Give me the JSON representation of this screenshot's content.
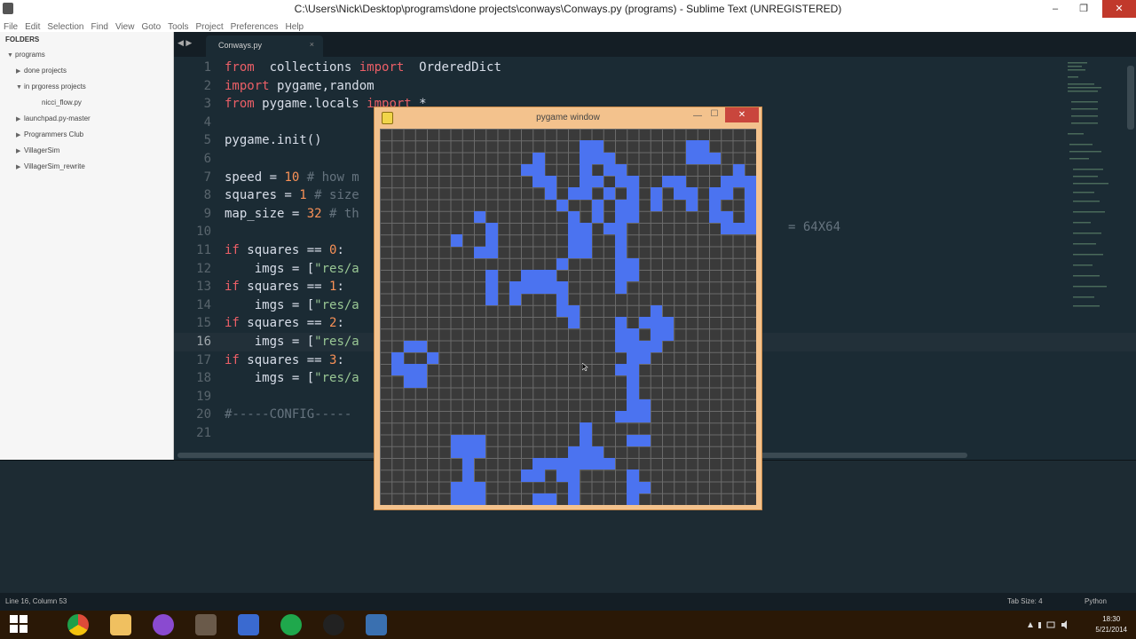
{
  "window": {
    "title": "C:\\Users\\Nick\\Desktop\\programs\\done projects\\conways\\Conways.py (programs) - Sublime Text (UNREGISTERED)",
    "minimize": "–",
    "maximize": "❐",
    "close": "✕"
  },
  "menu": [
    "File",
    "Edit",
    "Selection",
    "Find",
    "View",
    "Goto",
    "Tools",
    "Project",
    "Preferences",
    "Help"
  ],
  "sidebar": {
    "header": "FOLDERS",
    "items": [
      {
        "label": "programs",
        "arrow": "▼",
        "indent": 8
      },
      {
        "label": "done projects",
        "arrow": "▶",
        "indent": 18
      },
      {
        "label": "in prgoress projects",
        "arrow": "▼",
        "indent": 18
      },
      {
        "label": "nicci_flow.py",
        "arrow": "",
        "indent": 38
      },
      {
        "label": "launchpad.py-master",
        "arrow": "▶",
        "indent": 18
      },
      {
        "label": "Programmers Club",
        "arrow": "▶",
        "indent": 18
      },
      {
        "label": "VillagerSim",
        "arrow": "▶",
        "indent": 18
      },
      {
        "label": "VillagerSim_rewrite",
        "arrow": "▶",
        "indent": 18
      }
    ]
  },
  "tabs": {
    "nav": "◀ ▶",
    "active": "Conways.py",
    "close": "×"
  },
  "code": {
    "current_line": 16,
    "lines": [
      [
        [
          "kw",
          "from"
        ],
        [
          "",
          "  collections "
        ],
        [
          "kw",
          "import"
        ],
        [
          "",
          "  OrderedDict"
        ]
      ],
      [
        [
          "kw",
          "import"
        ],
        [
          "",
          " pygame,random"
        ]
      ],
      [
        [
          "kw",
          "from"
        ],
        [
          "",
          " pygame.locals "
        ],
        [
          "kw",
          "import"
        ],
        [
          "",
          " *"
        ]
      ],
      [],
      [
        [
          "",
          "pygame.init()"
        ]
      ],
      [],
      [
        [
          "",
          "speed = "
        ],
        [
          "num",
          "10"
        ],
        [
          "cm",
          " # how m"
        ]
      ],
      [
        [
          "",
          "squares = "
        ],
        [
          "num",
          "1"
        ],
        [
          "cm",
          " # size"
        ]
      ],
      [
        [
          "",
          "map_size = "
        ],
        [
          "num",
          "32"
        ],
        [
          "cm",
          " # th"
        ]
      ],
      [],
      [
        [
          "kw",
          "if"
        ],
        [
          "",
          " squares == "
        ],
        [
          "num",
          "0"
        ],
        [
          "",
          ":"
        ]
      ],
      [
        [
          "",
          "    imgs = ["
        ],
        [
          "str",
          "\"res/a"
        ]
      ],
      [
        [
          "kw",
          "if"
        ],
        [
          "",
          " squares == "
        ],
        [
          "num",
          "1"
        ],
        [
          "",
          ":"
        ]
      ],
      [
        [
          "",
          "    imgs = ["
        ],
        [
          "str",
          "\"res/a"
        ]
      ],
      [
        [
          "kw",
          "if"
        ],
        [
          "",
          " squares == "
        ],
        [
          "num",
          "2"
        ],
        [
          "",
          ":"
        ]
      ],
      [
        [
          "",
          "    imgs = ["
        ],
        [
          "str",
          "\"res/a"
        ]
      ],
      [
        [
          "kw",
          "if"
        ],
        [
          "",
          " squares == "
        ],
        [
          "num",
          "3"
        ],
        [
          "",
          ":"
        ]
      ],
      [
        [
          "",
          "    imgs = ["
        ],
        [
          "str",
          "\"res/a"
        ]
      ],
      [],
      [
        [
          "cm",
          "#-----CONFIG-----"
        ]
      ],
      []
    ],
    "hidden_comment_tail": "= 64X64"
  },
  "status": {
    "position": "Line 16, Column 53",
    "tab_size": "Tab Size: 4",
    "syntax": "Python"
  },
  "taskbar": {
    "apps": [
      {
        "name": "start-icon",
        "color": "#ffffff"
      },
      {
        "name": "chrome-icon",
        "color": "#dd4b39"
      },
      {
        "name": "file-explorer-icon",
        "color": "#f0c060"
      },
      {
        "name": "orb-app-icon",
        "color": "#8a4ad0"
      },
      {
        "name": "sublime-text-icon",
        "color": "#6a5a4a"
      },
      {
        "name": "editor-app-icon",
        "color": "#3a6ad0"
      },
      {
        "name": "hangouts-icon",
        "color": "#1fa84c"
      },
      {
        "name": "obs-icon",
        "color": "#222222"
      },
      {
        "name": "python-icon",
        "color": "#3a70b0"
      }
    ],
    "time": "18:30",
    "date": "5/21/2014"
  },
  "pygame": {
    "title": "pygame window",
    "minimize": "—",
    "maximize": "☐",
    "close": "✕",
    "grid_size": 32,
    "live_cells": [
      [
        17,
        1
      ],
      [
        18,
        1
      ],
      [
        26,
        1
      ],
      [
        27,
        1
      ],
      [
        13,
        2
      ],
      [
        17,
        2
      ],
      [
        18,
        2
      ],
      [
        19,
        2
      ],
      [
        26,
        2
      ],
      [
        27,
        2
      ],
      [
        28,
        2
      ],
      [
        12,
        3
      ],
      [
        13,
        3
      ],
      [
        17,
        3
      ],
      [
        19,
        3
      ],
      [
        20,
        3
      ],
      [
        30,
        3
      ],
      [
        13,
        4
      ],
      [
        14,
        4
      ],
      [
        17,
        4
      ],
      [
        18,
        4
      ],
      [
        20,
        4
      ],
      [
        21,
        4
      ],
      [
        24,
        4
      ],
      [
        25,
        4
      ],
      [
        29,
        4
      ],
      [
        30,
        4
      ],
      [
        31,
        4
      ],
      [
        14,
        5
      ],
      [
        16,
        5
      ],
      [
        17,
        5
      ],
      [
        19,
        5
      ],
      [
        21,
        5
      ],
      [
        23,
        5
      ],
      [
        25,
        5
      ],
      [
        26,
        5
      ],
      [
        28,
        5
      ],
      [
        29,
        5
      ],
      [
        31,
        5
      ],
      [
        15,
        6
      ],
      [
        18,
        6
      ],
      [
        20,
        6
      ],
      [
        21,
        6
      ],
      [
        23,
        6
      ],
      [
        26,
        6
      ],
      [
        28,
        6
      ],
      [
        31,
        6
      ],
      [
        8,
        7
      ],
      [
        16,
        7
      ],
      [
        18,
        7
      ],
      [
        20,
        7
      ],
      [
        21,
        7
      ],
      [
        28,
        7
      ],
      [
        29,
        7
      ],
      [
        31,
        7
      ],
      [
        9,
        8
      ],
      [
        16,
        8
      ],
      [
        17,
        8
      ],
      [
        19,
        8
      ],
      [
        20,
        8
      ],
      [
        29,
        8
      ],
      [
        30,
        8
      ],
      [
        31,
        8
      ],
      [
        6,
        9
      ],
      [
        9,
        9
      ],
      [
        16,
        9
      ],
      [
        17,
        9
      ],
      [
        20,
        9
      ],
      [
        8,
        10
      ],
      [
        9,
        10
      ],
      [
        16,
        10
      ],
      [
        17,
        10
      ],
      [
        20,
        10
      ],
      [
        15,
        11
      ],
      [
        20,
        11
      ],
      [
        21,
        11
      ],
      [
        9,
        12
      ],
      [
        12,
        12
      ],
      [
        13,
        12
      ],
      [
        14,
        12
      ],
      [
        20,
        12
      ],
      [
        21,
        12
      ],
      [
        9,
        13
      ],
      [
        11,
        13
      ],
      [
        12,
        13
      ],
      [
        13,
        13
      ],
      [
        14,
        13
      ],
      [
        15,
        13
      ],
      [
        20,
        13
      ],
      [
        9,
        14
      ],
      [
        11,
        14
      ],
      [
        15,
        14
      ],
      [
        15,
        15
      ],
      [
        16,
        15
      ],
      [
        23,
        15
      ],
      [
        16,
        16
      ],
      [
        20,
        16
      ],
      [
        22,
        16
      ],
      [
        23,
        16
      ],
      [
        24,
        16
      ],
      [
        20,
        17
      ],
      [
        21,
        17
      ],
      [
        23,
        17
      ],
      [
        24,
        17
      ],
      [
        2,
        18
      ],
      [
        3,
        18
      ],
      [
        20,
        18
      ],
      [
        21,
        18
      ],
      [
        22,
        18
      ],
      [
        23,
        18
      ],
      [
        1,
        19
      ],
      [
        4,
        19
      ],
      [
        21,
        19
      ],
      [
        22,
        19
      ],
      [
        1,
        20
      ],
      [
        2,
        20
      ],
      [
        3,
        20
      ],
      [
        20,
        20
      ],
      [
        21,
        20
      ],
      [
        2,
        21
      ],
      [
        3,
        21
      ],
      [
        21,
        21
      ],
      [
        21,
        22
      ],
      [
        21,
        23
      ],
      [
        22,
        23
      ],
      [
        20,
        24
      ],
      [
        21,
        24
      ],
      [
        22,
        24
      ],
      [
        17,
        25
      ],
      [
        6,
        26
      ],
      [
        7,
        26
      ],
      [
        8,
        26
      ],
      [
        17,
        26
      ],
      [
        21,
        26
      ],
      [
        22,
        26
      ],
      [
        6,
        27
      ],
      [
        7,
        27
      ],
      [
        8,
        27
      ],
      [
        16,
        27
      ],
      [
        17,
        27
      ],
      [
        18,
        27
      ],
      [
        7,
        28
      ],
      [
        13,
        28
      ],
      [
        14,
        28
      ],
      [
        15,
        28
      ],
      [
        16,
        28
      ],
      [
        17,
        28
      ],
      [
        18,
        28
      ],
      [
        19,
        28
      ],
      [
        7,
        29
      ],
      [
        12,
        29
      ],
      [
        13,
        29
      ],
      [
        15,
        29
      ],
      [
        16,
        29
      ],
      [
        21,
        29
      ],
      [
        6,
        30
      ],
      [
        7,
        30
      ],
      [
        8,
        30
      ],
      [
        16,
        30
      ],
      [
        21,
        30
      ],
      [
        22,
        30
      ],
      [
        6,
        31
      ],
      [
        7,
        31
      ],
      [
        8,
        31
      ],
      [
        13,
        31
      ],
      [
        14,
        31
      ],
      [
        16,
        31
      ],
      [
        21,
        31
      ]
    ]
  }
}
